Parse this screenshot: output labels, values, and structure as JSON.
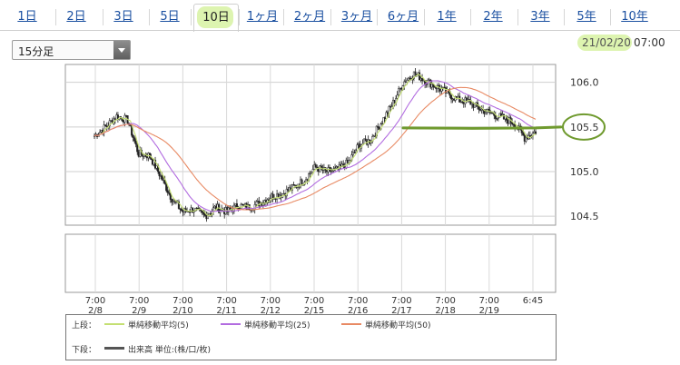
{
  "tabs": [
    {
      "label": "1日",
      "active": false
    },
    {
      "label": "2日",
      "active": false
    },
    {
      "label": "3日",
      "active": false
    },
    {
      "label": "5日",
      "active": false
    },
    {
      "label": "10日",
      "active": true
    },
    {
      "label": "1ヶ月",
      "active": false
    },
    {
      "label": "2ヶ月",
      "active": false
    },
    {
      "label": "3ヶ月",
      "active": false
    },
    {
      "label": "6ヶ月",
      "active": false
    },
    {
      "label": "1年",
      "active": false
    },
    {
      "label": "2年",
      "active": false
    },
    {
      "label": "3年",
      "active": false
    },
    {
      "label": "5年",
      "active": false
    },
    {
      "label": "10年",
      "active": false
    }
  ],
  "interval_select": {
    "value": "15分足"
  },
  "timestamp": {
    "date": "21/02/20",
    "time": "07:00"
  },
  "legend": {
    "upper_label": "上段：",
    "lower_label": "下段：",
    "items": [
      {
        "label": "単純移動平均(5)",
        "color": "#c4df72"
      },
      {
        "label": "単純移動平均(25)",
        "color": "#b26ce0"
      },
      {
        "label": "単純移動平均(50)",
        "color": "#e88a64"
      }
    ],
    "volume": {
      "label": "出来高 単位:(株/口/枚)",
      "color": "#555555"
    }
  },
  "colors": {
    "candle": "#222222",
    "annotation": "#6f9a2e",
    "highlight": "#d2f096"
  },
  "chart_data": {
    "type": "line",
    "ylim": [
      104.4,
      106.2
    ],
    "y_ticks": [
      "106.0",
      "105.5",
      "105.0",
      "104.5"
    ],
    "x_tick_labels": [
      {
        "time": "7:00",
        "date": "2/8"
      },
      {
        "time": "7:00",
        "date": "2/9"
      },
      {
        "time": "7:00",
        "date": "2/10"
      },
      {
        "time": "7:00",
        "date": "2/11"
      },
      {
        "time": "7:00",
        "date": "2/12"
      },
      {
        "time": "7:00",
        "date": "2/15"
      },
      {
        "time": "7:00",
        "date": "2/16"
      },
      {
        "time": "7:00",
        "date": "2/17"
      },
      {
        "time": "7:00",
        "date": "2/18"
      },
      {
        "time": "7:00",
        "date": "2/19"
      },
      {
        "time": "6:45",
        "date": ""
      }
    ],
    "price": [
      105.4,
      105.5,
      105.62,
      105.58,
      105.2,
      105.18,
      104.95,
      104.7,
      104.55,
      104.58,
      104.5,
      104.6,
      104.55,
      104.62,
      104.6,
      104.65,
      104.72,
      104.75,
      104.82,
      104.9,
      105.05,
      105.0,
      105.02,
      105.1,
      105.3,
      105.35,
      105.55,
      105.75,
      106.0,
      106.1,
      106.02,
      105.95,
      105.88,
      105.8,
      105.78,
      105.7,
      105.65,
      105.6,
      105.55,
      105.38,
      105.45
    ],
    "series": [
      {
        "name": "単純移動平均(5)",
        "window": 5
      },
      {
        "name": "単純移動平均(25)",
        "window": 25
      },
      {
        "name": "単純移動平均(50)",
        "window": 50
      }
    ],
    "annotation": {
      "value": "105.5"
    }
  }
}
